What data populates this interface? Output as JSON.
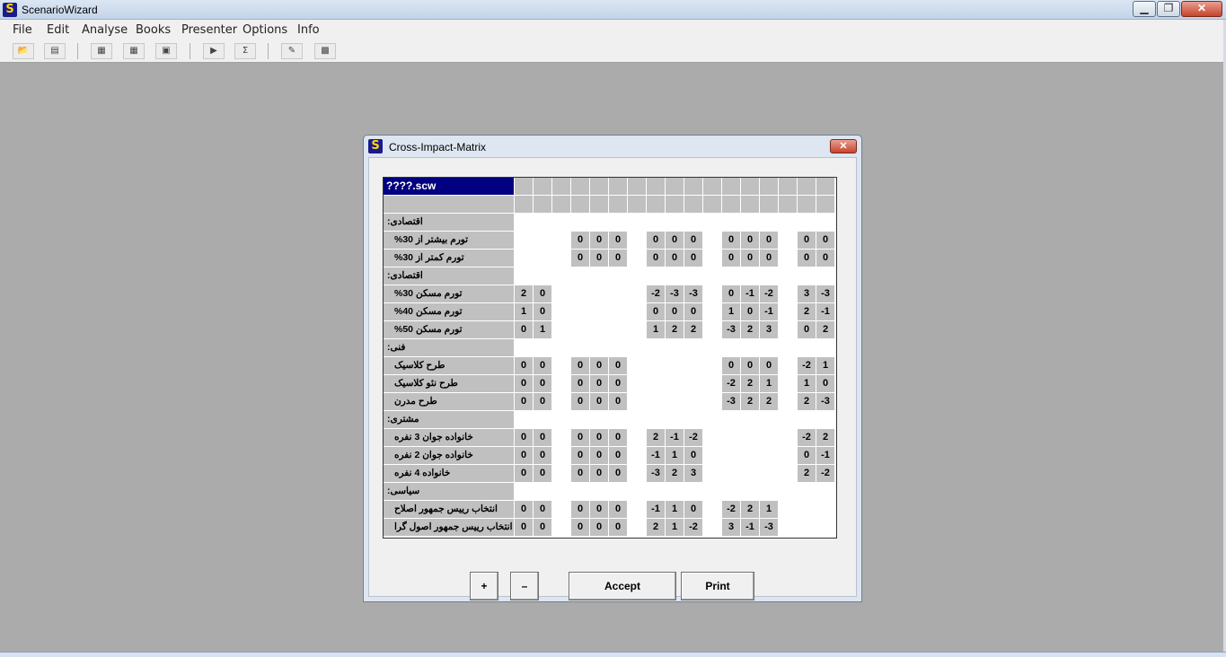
{
  "window": {
    "title": "ScenarioWizard",
    "icon": "scenariowizard-app-icon",
    "icon_glyph": "S",
    "minimize": "▁",
    "maximize": "❐",
    "close": "✕"
  },
  "menu": [
    "File",
    "Edit",
    "Analyse",
    "Books",
    "Presenter",
    "Options",
    "Info"
  ],
  "toolbar": {
    "icons": [
      "open-folder-icon",
      "save-icon",
      "list-view-icon",
      "grid-view-icon",
      "matrix-icon",
      "play-icon",
      "sigma-icon",
      "wrench-icon",
      "settings-grid-icon"
    ],
    "glyphs": [
      "📂",
      "▤",
      "▦",
      "▦",
      "▣",
      "▶",
      "Σ",
      "✎",
      "▩"
    ]
  },
  "dialog": {
    "title": "Cross-Impact-Matrix",
    "close": "✕",
    "filename": "????.scw",
    "buttons": {
      "plus": "+",
      "minus": "–",
      "accept": "Accept",
      "print": "Print"
    }
  },
  "matrix": {
    "rows": [
      {
        "type": "desc",
        "label": "اقتصادی:"
      },
      {
        "type": "var",
        "label": "تورم بیشتر از 30%",
        "values": [
          "",
          "",
          "0",
          "0",
          "0",
          "0",
          "0",
          "0",
          "0",
          "0",
          "0",
          "0",
          "0"
        ]
      },
      {
        "type": "var",
        "label": "تورم کمتر از 30%",
        "values": [
          "",
          "",
          "0",
          "0",
          "0",
          "0",
          "0",
          "0",
          "0",
          "0",
          "0",
          "0",
          "0"
        ]
      },
      {
        "type": "desc",
        "label": "اقتصادی:"
      },
      {
        "type": "var",
        "label": "تورم مسکن 30%",
        "values": [
          "2",
          "0",
          "",
          "",
          "",
          "-2",
          "-3",
          "-3",
          "0",
          "-1",
          "-2",
          "3",
          "-3"
        ]
      },
      {
        "type": "var",
        "label": "تورم مسکن 40%",
        "values": [
          "1",
          "0",
          "",
          "",
          "",
          "0",
          "0",
          "0",
          "1",
          "0",
          "-1",
          "2",
          "-1"
        ]
      },
      {
        "type": "var",
        "label": "تورم مسکن 50%",
        "values": [
          "0",
          "1",
          "",
          "",
          "",
          "1",
          "2",
          "2",
          "-3",
          "2",
          "3",
          "0",
          "2"
        ]
      },
      {
        "type": "desc",
        "label": "فنی:"
      },
      {
        "type": "var",
        "label": "طرح کلاسیک",
        "values": [
          "0",
          "0",
          "0",
          "0",
          "0",
          "",
          "",
          "",
          "0",
          "0",
          "0",
          "-2",
          "1"
        ]
      },
      {
        "type": "var",
        "label": "طرح نئو کلاسیک",
        "values": [
          "0",
          "0",
          "0",
          "0",
          "0",
          "",
          "",
          "",
          "-2",
          "2",
          "1",
          "1",
          "0"
        ]
      },
      {
        "type": "var",
        "label": "طرح مدرن",
        "values": [
          "0",
          "0",
          "0",
          "0",
          "0",
          "",
          "",
          "",
          "-3",
          "2",
          "2",
          "2",
          "-3"
        ]
      },
      {
        "type": "desc",
        "label": "مشتری:"
      },
      {
        "type": "var",
        "label": "خانواده جوان 3 نفره",
        "values": [
          "0",
          "0",
          "0",
          "0",
          "0",
          "2",
          "-1",
          "-2",
          "",
          "",
          "",
          "-2",
          "2"
        ]
      },
      {
        "type": "var",
        "label": "خانواده جوان 2 نفره",
        "values": [
          "0",
          "0",
          "0",
          "0",
          "0",
          "-1",
          "1",
          "0",
          "",
          "",
          "",
          "0",
          "-1"
        ]
      },
      {
        "type": "var",
        "label": "خانواده 4 نفره",
        "values": [
          "0",
          "0",
          "0",
          "0",
          "0",
          "-3",
          "2",
          "3",
          "",
          "",
          "",
          "2",
          "-2"
        ]
      },
      {
        "type": "desc",
        "label": "سیاسی:"
      },
      {
        "type": "var",
        "label": "انتخاب رییس جمهور اصلاح طلب",
        "values": [
          "0",
          "0",
          "0",
          "0",
          "0",
          "-1",
          "1",
          "0",
          "-2",
          "2",
          "1",
          "",
          ""
        ]
      },
      {
        "type": "var",
        "label": "انتخاب رییس جمهور اصول گرا",
        "values": [
          "0",
          "0",
          "0",
          "0",
          "0",
          "2",
          "1",
          "-2",
          "3",
          "-1",
          "-3",
          "",
          ""
        ]
      }
    ]
  }
}
